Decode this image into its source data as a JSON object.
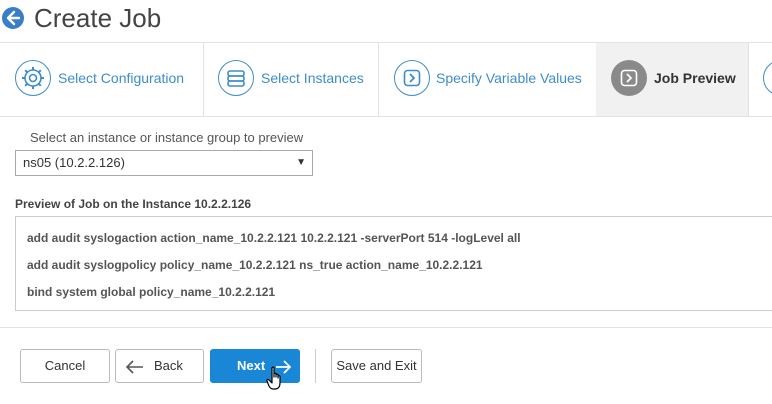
{
  "header": {
    "title": "Create Job",
    "back_icon": "arrow-left-icon"
  },
  "steps": [
    {
      "label": "Select Configuration",
      "icon": "gear-icon",
      "active": false
    },
    {
      "label": "Select Instances",
      "icon": "stack-icon",
      "active": false
    },
    {
      "label": "Specify Variable Values",
      "icon": "chevron-right-icon",
      "active": false
    },
    {
      "label": "Job Preview",
      "icon": "chevron-right-icon",
      "active": true
    }
  ],
  "instance_select": {
    "label": "Select an instance or instance group to preview",
    "value": "ns05 (10.2.2.126)"
  },
  "preview": {
    "label": "Preview of Job on the Instance 10.2.2.126",
    "commands": [
      "add audit syslogaction action_name_10.2.2.121 10.2.2.121 -serverPort 514 -logLevel all",
      "add audit syslogpolicy policy_name_10.2.2.121 ns_true action_name_10.2.2.121",
      "bind system global policy_name_10.2.2.121"
    ]
  },
  "footer": {
    "cancel": "Cancel",
    "back": "Back",
    "next": "Next",
    "save_exit": "Save and Exit"
  },
  "colors": {
    "accent": "#3e8dcb",
    "primary_button": "#1a86d6",
    "active_step_bg": "#f1f1f1"
  }
}
